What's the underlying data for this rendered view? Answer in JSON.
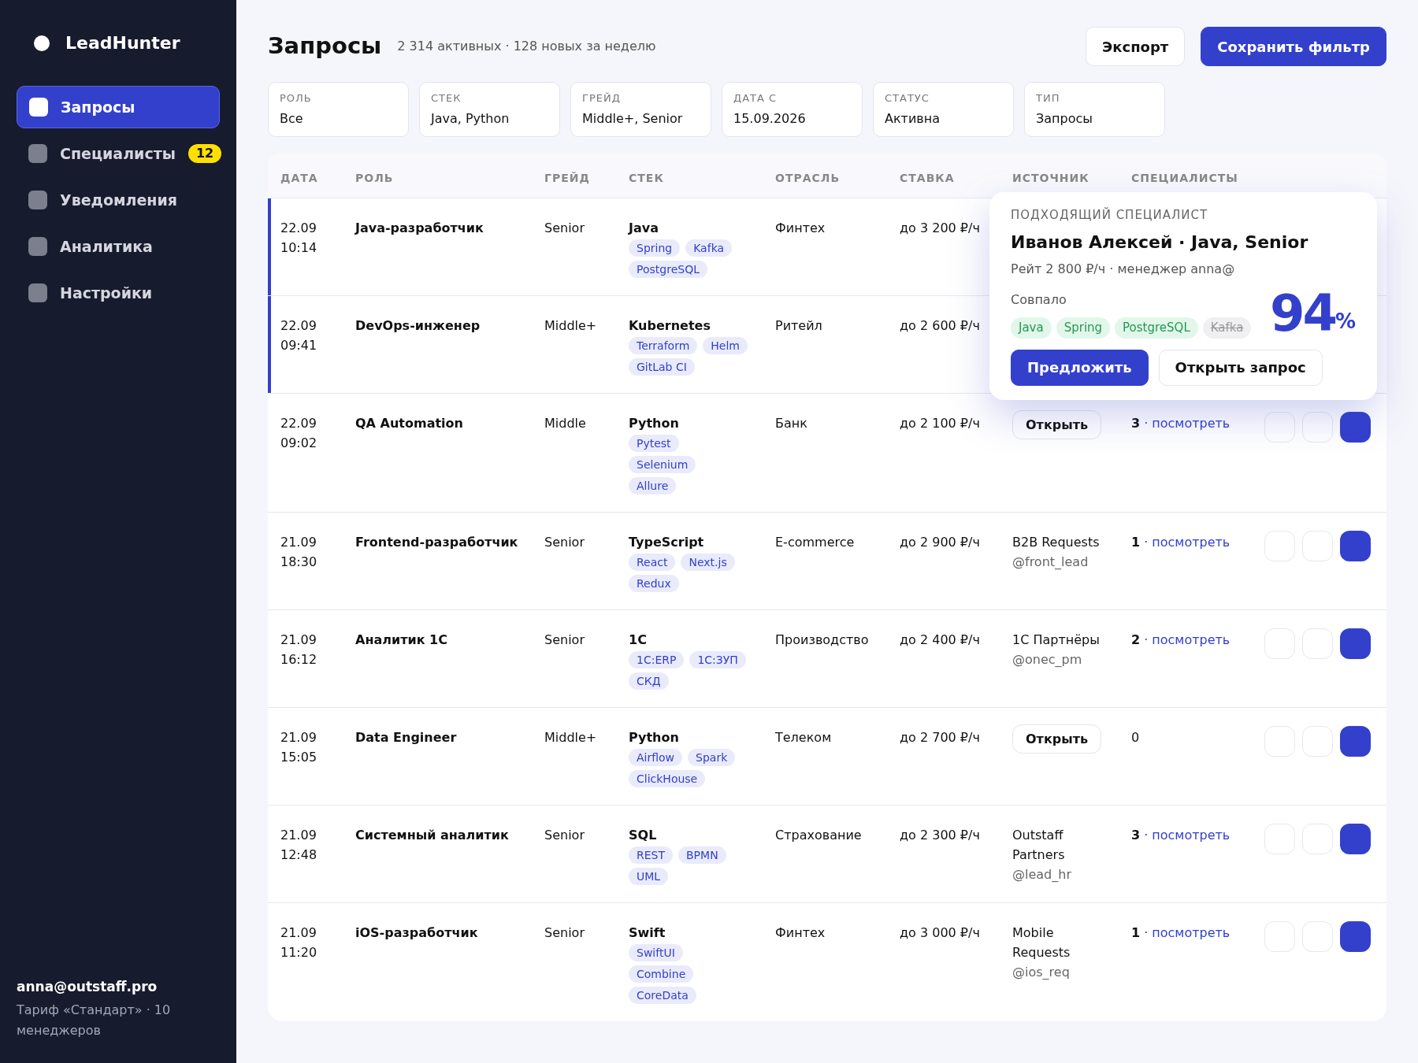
{
  "brand": {
    "name": "LeadHunter"
  },
  "nav": [
    {
      "label": "Запросы",
      "selected": true
    },
    {
      "label": "Специалисты",
      "selected": false,
      "badge": "12"
    },
    {
      "label": "Уведомления",
      "selected": false
    },
    {
      "label": "Аналитика",
      "selected": false
    },
    {
      "label": "Настройки",
      "selected": false
    }
  ],
  "account": {
    "email": "anna@outstaff.pro",
    "plan": "Тариф «Стандарт» · 10 менеджеров"
  },
  "header": {
    "title": "Запросы",
    "subtitle": "2 314 активных · 128 новых за неделю",
    "buttons": [
      {
        "label": "Экспорт",
        "kind": "secondary"
      },
      {
        "label": "Сохранить фильтр",
        "kind": "primary"
      }
    ]
  },
  "filters": [
    {
      "label": "РОЛЬ",
      "value": "Все"
    },
    {
      "label": "СТЕК",
      "value": "Java, Python"
    },
    {
      "label": "ГРЕЙД",
      "value": "Middle+, Senior"
    },
    {
      "label": "ДАТА С",
      "value": "15.09.2026"
    },
    {
      "label": "СТАТУС",
      "value": "Активна"
    },
    {
      "label": "ТИП",
      "value": "Запросы"
    }
  ],
  "table": {
    "columns": [
      "ДАТА",
      "РОЛЬ",
      "ГРЕЙД",
      "СТЕК",
      "ОТРАСЛЬ",
      "СТАВКА",
      "ИСТОЧНИК",
      "СПЕЦИАЛИСТЫ"
    ],
    "rows": [
      {
        "date": "22.09",
        "time": "10:14",
        "role": "Java-разработчик",
        "grade": "Senior",
        "stack": "Java",
        "tags": [
          "Spring",
          "Kafka",
          "PostgreSQL"
        ],
        "industry": "Финтех",
        "rate": "до 3 200 ₽/ч",
        "highlighted": true
      },
      {
        "date": "22.09",
        "time": "09:41",
        "role": "DevOps-инженер",
        "grade": "Middle+",
        "stack": "Kubernetes",
        "tags": [
          "Terraform",
          "Helm",
          "GitLab CI"
        ],
        "industry": "Ритейл",
        "rate": "до 2 600 ₽/ч",
        "highlighted": true
      },
      {
        "date": "22.09",
        "time": "09:02",
        "role": "QA Automation",
        "grade": "Middle",
        "stack": "Python",
        "tags": [
          "Pytest",
          "Selenium",
          "Allure"
        ],
        "industry": "Банк",
        "rate": "до 2 100 ₽/ч",
        "highlighted": false,
        "source": {
          "kind": "button",
          "label": "Открыть"
        },
        "specialists": {
          "count": "3",
          "link": "· посмотреть"
        },
        "actions": true
      },
      {
        "date": "21.09",
        "time": "18:30",
        "role": "Frontend-разработчик",
        "grade": "Senior",
        "stack": "TypeScript",
        "tags": [
          "React",
          "Next.js",
          "Redux"
        ],
        "industry": "E-commerce",
        "rate": "до 2 900 ₽/ч",
        "highlighted": false,
        "source": {
          "kind": "text",
          "name": "B2B Requests",
          "handle": "@front_lead"
        },
        "specialists": {
          "count": "1",
          "link": "· посмотреть"
        },
        "actions": true
      },
      {
        "date": "21.09",
        "time": "16:12",
        "role": "Аналитик 1С",
        "grade": "Senior",
        "stack": "1С",
        "tags": [
          "1С:ERP",
          "1С:ЗУП",
          "СКД"
        ],
        "industry": "Производство",
        "rate": "до 2 400 ₽/ч",
        "highlighted": false,
        "source": {
          "kind": "text",
          "name": "1С Партнёры",
          "handle": "@onec_pm"
        },
        "specialists": {
          "count": "2",
          "link": "· посмотреть"
        },
        "actions": true
      },
      {
        "date": "21.09",
        "time": "15:05",
        "role": "Data Engineer",
        "grade": "Middle+",
        "stack": "Python",
        "tags": [
          "Airflow",
          "Spark",
          "ClickHouse"
        ],
        "industry": "Телеком",
        "rate": "до 2 700 ₽/ч",
        "highlighted": false,
        "source": {
          "kind": "button",
          "label": "Открыть"
        },
        "specialists": {
          "count": "0"
        },
        "actions": true
      },
      {
        "date": "21.09",
        "time": "12:48",
        "role": "Системный аналитик",
        "grade": "Senior",
        "stack": "SQL",
        "tags": [
          "REST",
          "BPMN",
          "UML"
        ],
        "industry": "Страхование",
        "rate": "до 2 300 ₽/ч",
        "highlighted": false,
        "source": {
          "kind": "text",
          "name": "Outstaff Partners",
          "handle": "@lead_hr"
        },
        "specialists": {
          "count": "3",
          "link": "· посмотреть"
        },
        "actions": true
      },
      {
        "date": "21.09",
        "time": "11:20",
        "role": "iOS-разработчик",
        "grade": "Senior",
        "stack": "Swift",
        "tags": [
          "SwiftUI",
          "Combine",
          "CoreData"
        ],
        "industry": "Финтех",
        "rate": "до 3 000 ₽/ч",
        "highlighted": false,
        "source": {
          "kind": "text",
          "name": "Mobile Requests",
          "handle": "@ios_req"
        },
        "specialists": {
          "count": "1",
          "link": "· посмотреть"
        },
        "actions": true
      }
    ]
  },
  "popup": {
    "caption": "ПОДХОДЯЩИЙ СПЕЦИАЛИСТ",
    "name": "Иванов Алексей · Java, Senior",
    "meta": "Рейт 2 800 ₽/ч · менеджер anna@",
    "match_label": "Совпало",
    "skills": [
      {
        "label": "Java",
        "matched": true
      },
      {
        "label": "Spring",
        "matched": true
      },
      {
        "label": "PostgreSQL",
        "matched": true
      },
      {
        "label": "Kafka",
        "matched": false
      }
    ],
    "score": "94",
    "unit": "%",
    "buttons": [
      {
        "label": "Предложить",
        "kind": "primary"
      },
      {
        "label": "Открыть запрос",
        "kind": "secondary"
      }
    ]
  }
}
